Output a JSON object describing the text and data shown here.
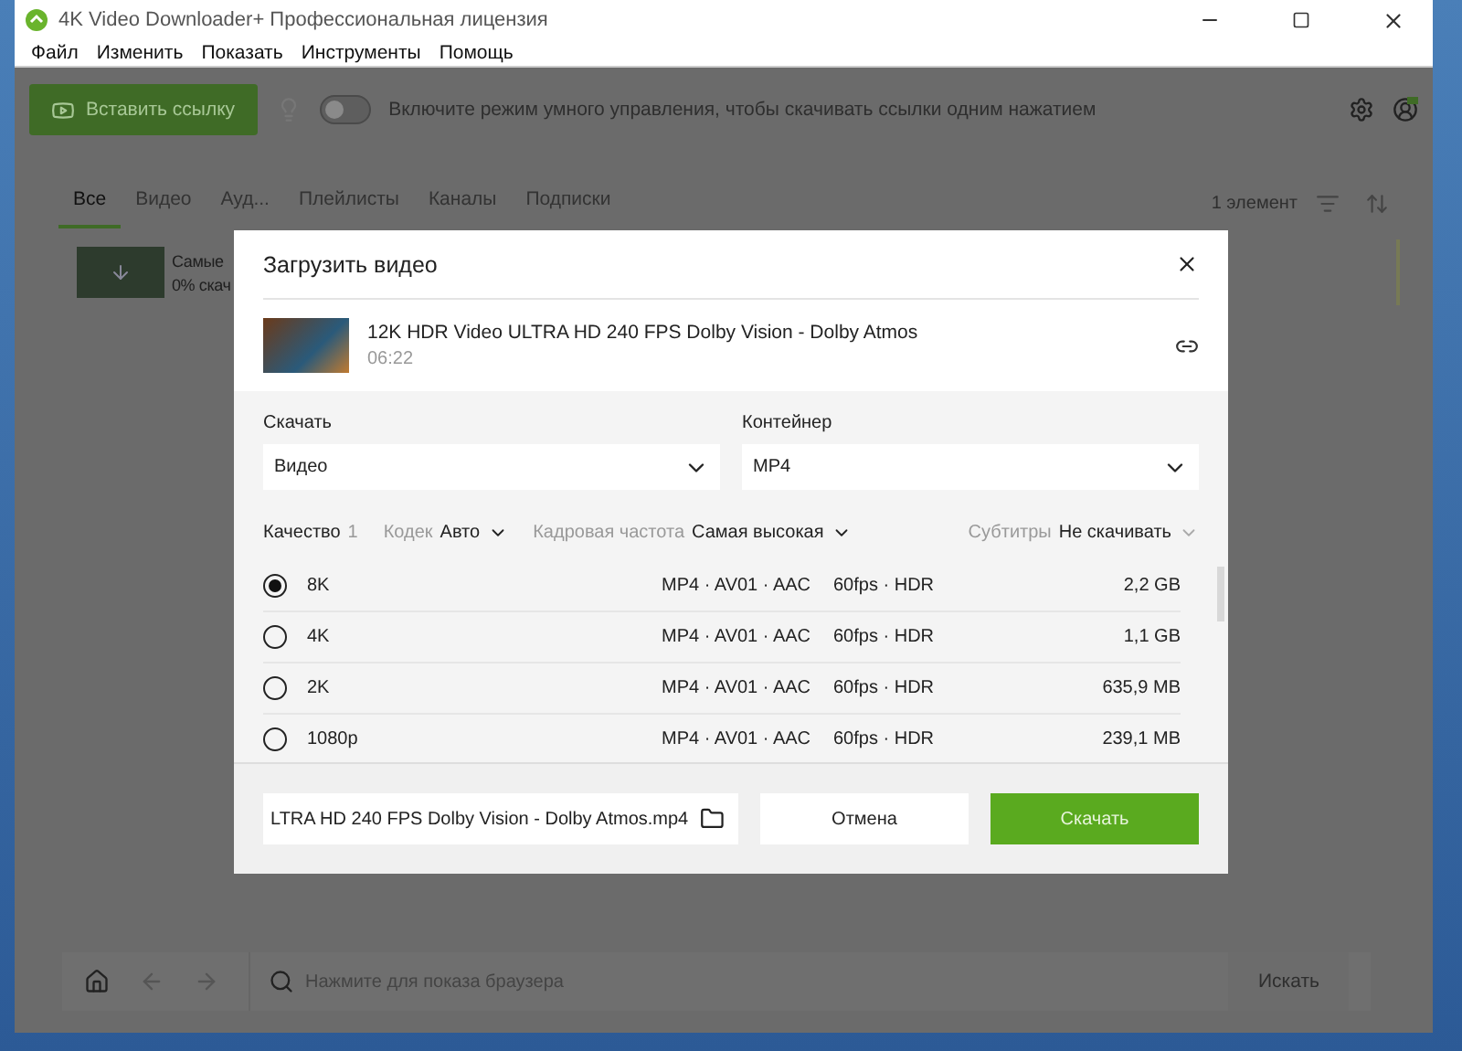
{
  "window": {
    "title": "4K Video Downloader+ Профессиональная лицензия"
  },
  "menu": [
    "Файл",
    "Изменить",
    "Показать",
    "Инструменты",
    "Помощь"
  ],
  "toolbar": {
    "paste_button": "Вставить ссылку",
    "smart_mode": {
      "on": false
    },
    "hint": "Включите режим умного управления, чтобы скачивать ссылки одним нажатием"
  },
  "tabs": [
    {
      "label": "Все",
      "selected": true
    },
    {
      "label": "Видео",
      "selected": false
    },
    {
      "label": "Ауд...",
      "selected": false
    },
    {
      "label": "Плейлисты",
      "selected": false
    },
    {
      "label": "Каналы",
      "selected": false
    },
    {
      "label": "Подписки",
      "selected": false
    }
  ],
  "item_count": "1 элемент",
  "downloads": [
    {
      "title": "Самые",
      "status": "0% скач"
    }
  ],
  "dialog": {
    "title": "Загрузить видео",
    "video": {
      "title": "12K HDR Video ULTRA HD 240 FPS Dolby Vision - Dolby Atmos",
      "duration": "06:22"
    },
    "download": {
      "label": "Скачать",
      "value": "Видео"
    },
    "container": {
      "label": "Контейнер",
      "value": "MP4"
    },
    "quality": {
      "label": "Качество",
      "info": "1"
    },
    "filters": [
      {
        "label": "Кодек",
        "value": "Авто"
      },
      {
        "label": "Кадровая частота",
        "value": "Самая высокая"
      }
    ],
    "subtitles": {
      "label": "Субтитры",
      "value": "Не скачивать"
    },
    "options": [
      {
        "name": "8K",
        "format": "MP4 · AV01 · AAC",
        "fps": "60fps · HDR",
        "size": "2,2 GB",
        "selected": true
      },
      {
        "name": "4K",
        "format": "MP4 · AV01 · AAC",
        "fps": "60fps · HDR",
        "size": "1,1 GB",
        "selected": false
      },
      {
        "name": "2K",
        "format": "MP4 · AV01 · AAC",
        "fps": "60fps · HDR",
        "size": "635,9 MB",
        "selected": false
      },
      {
        "name": "1080p",
        "format": "MP4 · AV01 · AAC",
        "fps": "60fps · HDR",
        "size": "239,1 MB",
        "selected": false
      }
    ],
    "filename": "LTRA HD 240 FPS Dolby Vision - Dolby Atmos.mp4",
    "cancel": "Отмена",
    "confirm": "Скачать"
  },
  "browser_bar": {
    "placeholder": "Нажмите для показа браузера",
    "search_button": "Искать"
  }
}
